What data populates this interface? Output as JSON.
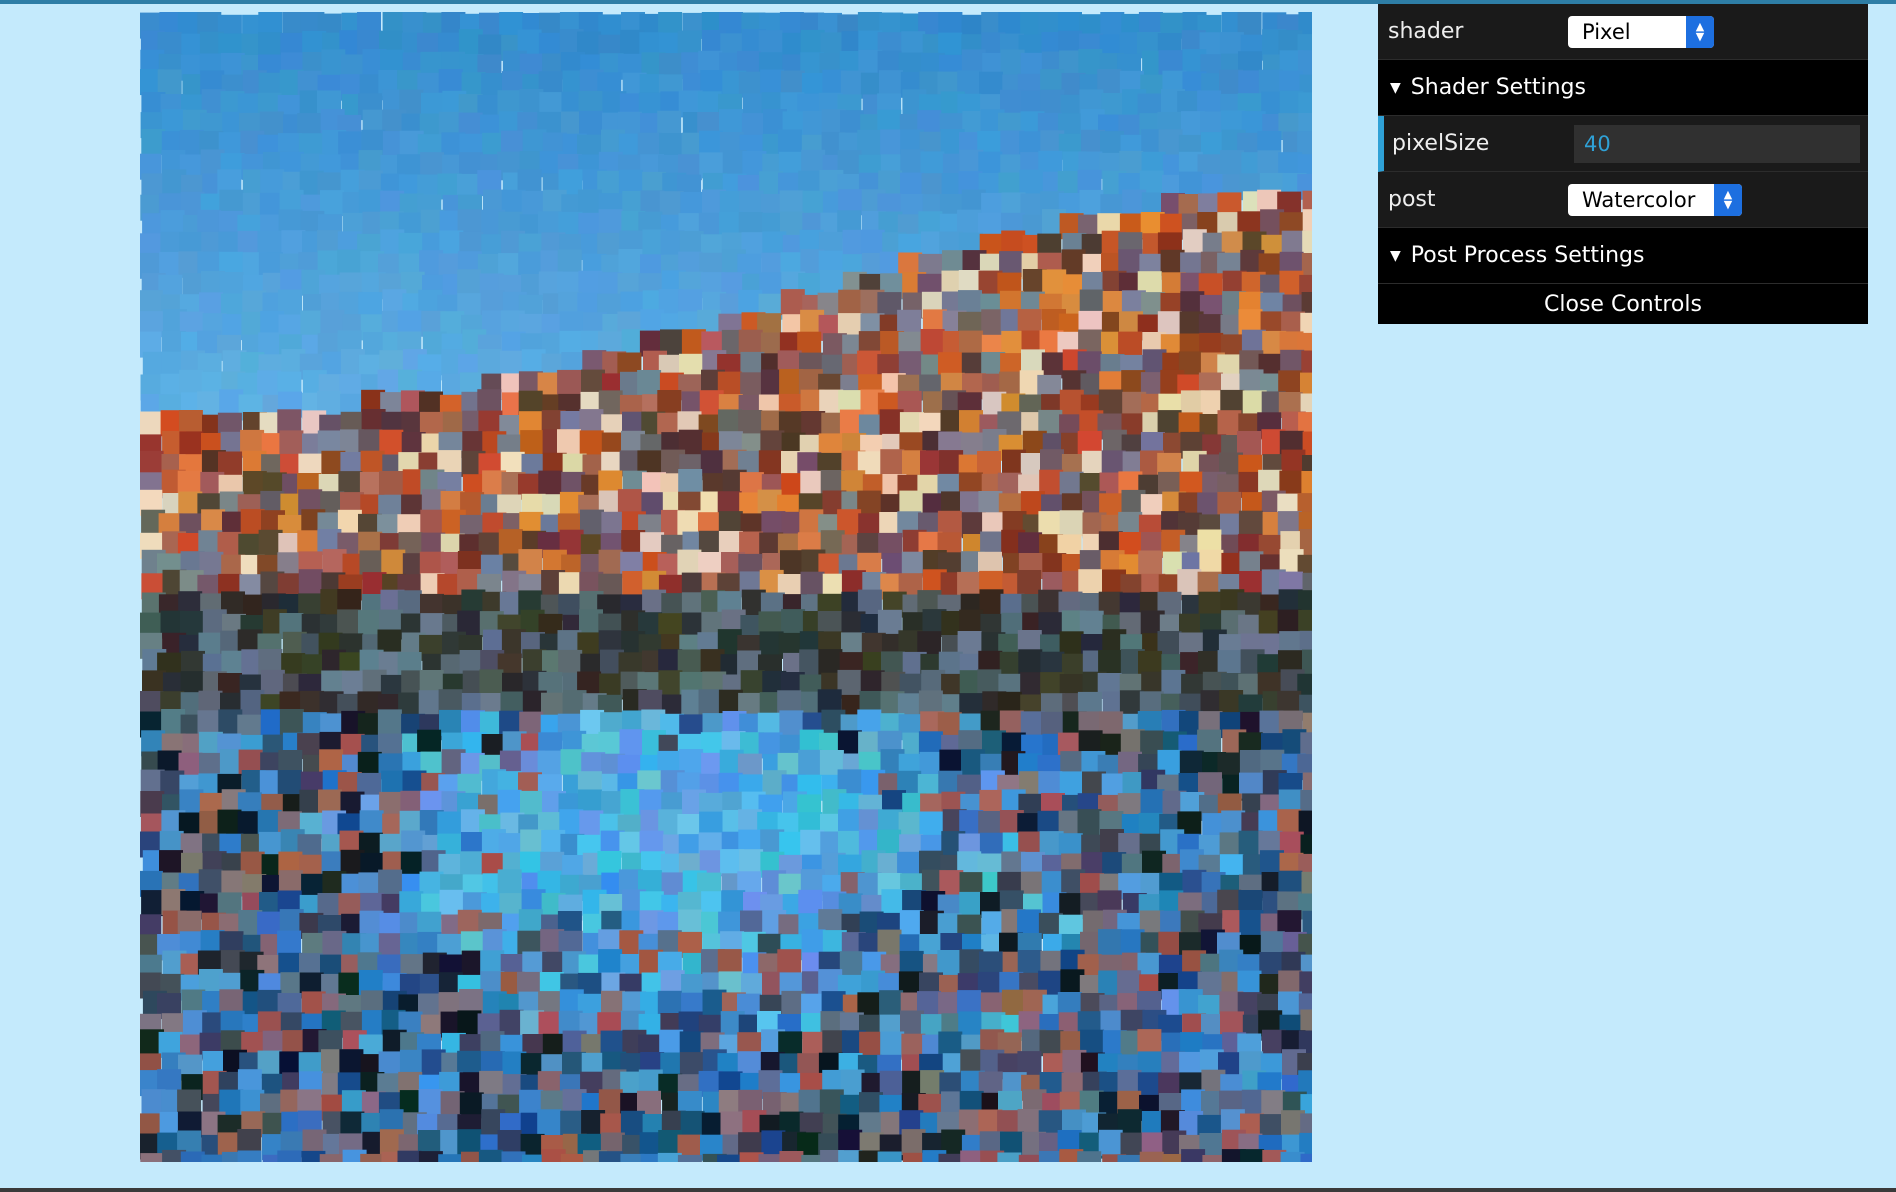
{
  "gui": {
    "shader": {
      "label": "shader",
      "value": "Pixel"
    },
    "shader_folder": {
      "title": "Shader Settings"
    },
    "pixel_size": {
      "label": "pixelSize",
      "value": "40"
    },
    "post": {
      "label": "post",
      "value": "Watercolor"
    },
    "post_folder": {
      "title": "Post Process Settings"
    },
    "close_label": "Close Controls",
    "accent_color": "#2fa1d6",
    "select_arrow_color": "#1d6fe0"
  },
  "icons": {
    "folder_open": "triangle-down-icon",
    "select_arrows": "updown-arrows-icon"
  },
  "canvas": {
    "content": "pixelated watercolor landscape with blue sky, autumn trees and lake reflection"
  }
}
